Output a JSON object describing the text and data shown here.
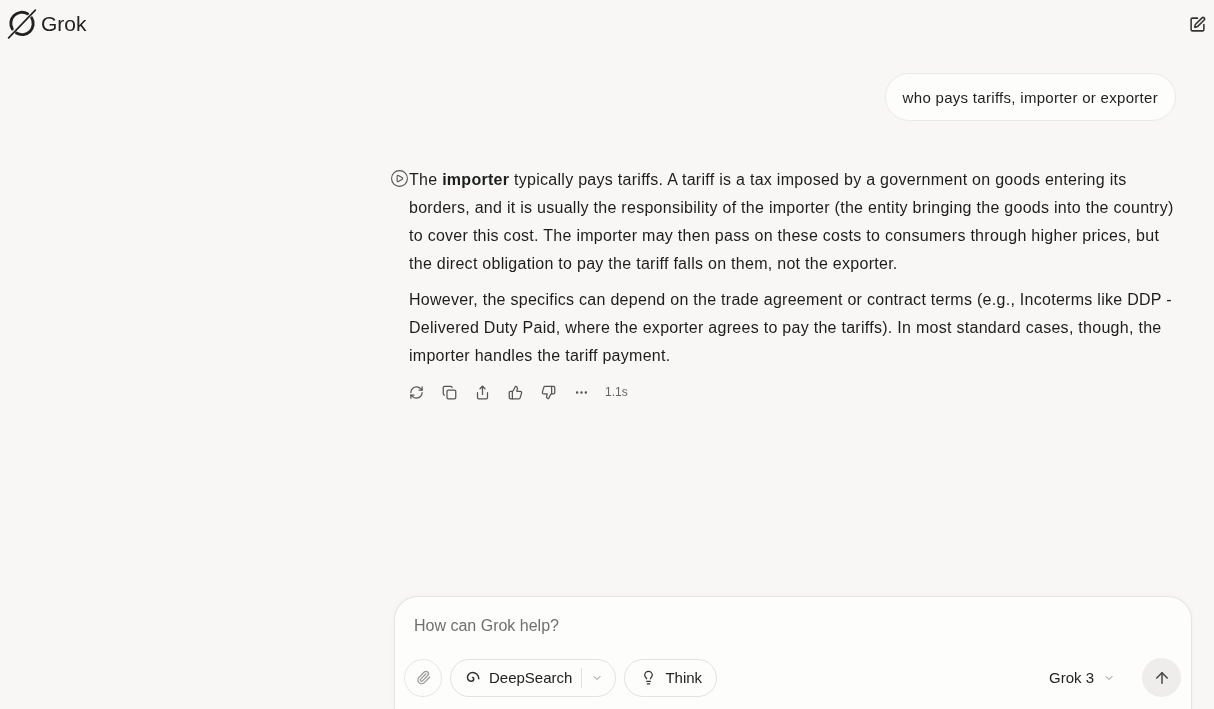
{
  "header": {
    "brand": "Grok"
  },
  "messages": [
    {
      "kind": "user",
      "text": "who pays tariffs, importer or exporter"
    },
    {
      "kind": "response",
      "paragraphs": [
        "The **importer** typically pays tariffs. A tariff is a tax imposed by a government on goods entering its borders, and it is usually the responsibility of the importer (the entity bringing the goods into the country) to cover this cost. The importer may then pass on these costs to consumers through higher prices, but the direct obligation to pay the tariff falls on them, not the exporter.",
        "However, the specifics can depend on the trade agreement or contract terms (e.g., Incoterms like DDP - Delivered Duty Paid, where the exporter agrees to pay the tariffs). In most standard cases, though, the importer handles the tariff payment."
      ],
      "response_time": "1.1s"
    }
  ],
  "composer": {
    "placeholder": "How can Grok help?",
    "tools": [
      {
        "kind": "deepsearch",
        "label": "DeepSearch"
      },
      {
        "kind": "think",
        "label": "Think"
      }
    ],
    "model": "Grok 3"
  }
}
